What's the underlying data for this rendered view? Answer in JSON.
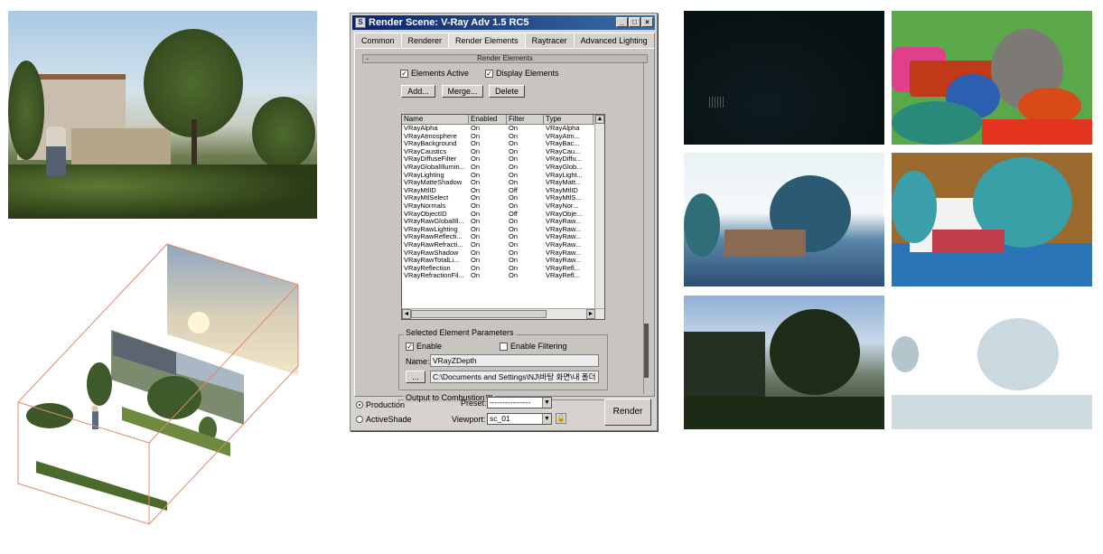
{
  "dialog": {
    "title": "Render Scene: V-Ray Adv 1.5 RC5",
    "window_buttons": [
      "_",
      "□",
      "×"
    ],
    "tabs": [
      {
        "label": "Common",
        "active": false
      },
      {
        "label": "Renderer",
        "active": false
      },
      {
        "label": "Render Elements",
        "active": true
      },
      {
        "label": "Raytracer",
        "active": false
      },
      {
        "label": "Advanced Lighting",
        "active": false
      }
    ],
    "rollout_title": "Render Elements",
    "rollout_toggle": "-",
    "elements_active": {
      "label": "Elements Active",
      "checked": true
    },
    "display_elements": {
      "label": "Display Elements",
      "checked": true
    },
    "buttons": {
      "add": "Add...",
      "merge": "Merge...",
      "delete": "Delete"
    },
    "columns": [
      "Name",
      "Enabled",
      "Filter",
      "Type"
    ],
    "rows": [
      [
        "VRayAlpha",
        "On",
        "On",
        "VRayAlpha"
      ],
      [
        "VRayAtmosphere",
        "On",
        "On",
        "VRayAtm..."
      ],
      [
        "VRayBackground",
        "On",
        "On",
        "VRayBac..."
      ],
      [
        "VRayCaustics",
        "On",
        "On",
        "VRayCau..."
      ],
      [
        "VRayDiffuseFilter",
        "On",
        "On",
        "VRayDiffu..."
      ],
      [
        "VRayGlobalIllumin...",
        "On",
        "On",
        "VRayGlob..."
      ],
      [
        "VRayLighting",
        "On",
        "On",
        "VRayLight..."
      ],
      [
        "VRayMatteShadow",
        "On",
        "On",
        "VRayMatt..."
      ],
      [
        "VRayMtlID",
        "On",
        "Off",
        "VRayMtlID"
      ],
      [
        "VRayMtlSelect",
        "On",
        "On",
        "VRayMtlS..."
      ],
      [
        "VRayNormals",
        "On",
        "On",
        "VRayNor..."
      ],
      [
        "VRayObjectID",
        "On",
        "Off",
        "VRayObje..."
      ],
      [
        "VRayRawGlobalIll...",
        "On",
        "On",
        "VRayRaw..."
      ],
      [
        "VRayRawLighting",
        "On",
        "On",
        "VRayRaw..."
      ],
      [
        "VRayRawReflecti...",
        "On",
        "On",
        "VRayRaw..."
      ],
      [
        "VRayRawRefracti...",
        "On",
        "On",
        "VRayRaw..."
      ],
      [
        "VRayRawShadow",
        "On",
        "On",
        "VRayRaw..."
      ],
      [
        "VRayRawTotalLi...",
        "On",
        "On",
        "VRayRaw..."
      ],
      [
        "VRayReflection",
        "On",
        "On",
        "VRayRefl..."
      ],
      [
        "VRayRefractionFil...",
        "On",
        "On",
        "VRayRefl..."
      ]
    ],
    "selected_params": {
      "group_label": "Selected Element Parameters",
      "enable": {
        "label": "Enable",
        "checked": true
      },
      "enable_filtering": {
        "label": "Enable Filtering",
        "checked": false
      },
      "name_label": "Name:",
      "name_value": "VRayZDepth",
      "browse": "...",
      "path_value": "C:\\Documents and Settings\\NJ\\바탕 화면\\내 폴더"
    },
    "combustion_label": "Output to Combustion™",
    "production": {
      "label": "Production",
      "selected": true
    },
    "activeshade": {
      "label": "ActiveShade",
      "selected": false
    },
    "preset_label": "Preset:",
    "preset_value": "----------------",
    "viewport_label": "Viewport:",
    "viewport_value": "sc_01",
    "render_button": "Render"
  },
  "colors": {
    "titlebar": "#0a246a",
    "dialog_bg": "#d6d3ce"
  }
}
